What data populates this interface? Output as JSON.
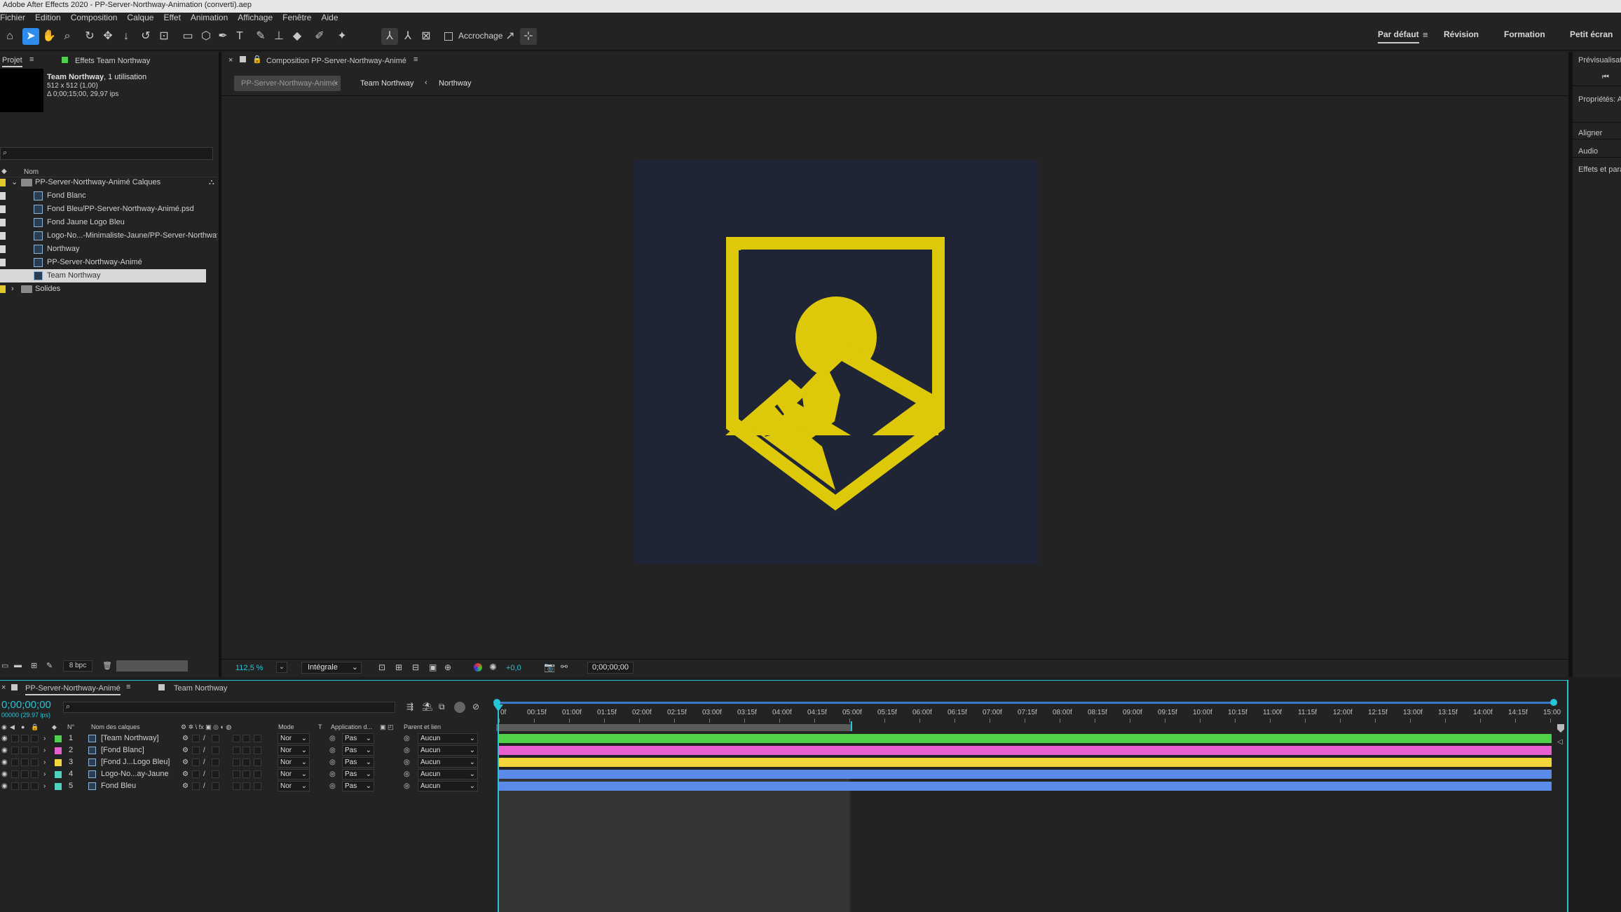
{
  "window_title": "Adobe After Effects 2020 - PP-Server-Northway-Animation (converti).aep",
  "menu": [
    "Fichier",
    "Edition",
    "Composition",
    "Calque",
    "Effet",
    "Animation",
    "Affichage",
    "Fenêtre",
    "Aide"
  ],
  "toolbar": {
    "snapping_label": "Accrochage",
    "workspaces": [
      "Par défaut",
      "Révision",
      "Formation",
      "Petit écran"
    ]
  },
  "project_panel": {
    "tab_label": "Projet",
    "effects_tab": "Effets Team Northway",
    "info_name": "Team Northway",
    "info_usage": ", 1 utilisation",
    "info_size": "512 x 512 (1,00)",
    "info_duration": "Δ 0;00;15;00, 29,97 ips",
    "search_placeholder": "",
    "col_name": "Nom",
    "items": [
      {
        "name": "PP-Server-Northway-Animé Calques",
        "type": "folder",
        "label_color": "#e0c72b"
      },
      {
        "name": "Fond Blanc",
        "type": "layer",
        "label_color": "#d8d8d8"
      },
      {
        "name": "Fond Bleu/PP-Server-Northway-Animé.psd",
        "type": "psd",
        "label_color": "#d8d8d8"
      },
      {
        "name": "Fond Jaune Logo Bleu",
        "type": "layer",
        "label_color": "#d8d8d8"
      },
      {
        "name": "Logo-No...-Minimaliste-Jaune/PP-Server-Northway",
        "type": "psd",
        "label_color": "#d8d8d8"
      },
      {
        "name": "Northway",
        "type": "comp",
        "label_color": "#d8d8d8"
      },
      {
        "name": "PP-Server-Northway-Animé",
        "type": "comp",
        "label_color": "#d8d8d8"
      },
      {
        "name": "Team Northway",
        "type": "comp",
        "label_color": "#d8d8d8",
        "selected": true
      },
      {
        "name": "Solides",
        "type": "folder",
        "label_color": "#e0c72b"
      }
    ],
    "bpc": "8 bpc"
  },
  "comp_panel": {
    "tab_label": "Composition PP-Server-Northway-Animé",
    "breadcrumbs": [
      "PP-Server-Northway-Animé",
      "Team Northway",
      "Northway"
    ],
    "zoom": "112,5 %",
    "resolution": "Intégrale",
    "exposure": "+0,0",
    "timecode": "0;00;00;00"
  },
  "right_panel": {
    "items": [
      "Prévisualisation",
      "Propriétés: A",
      "Aligner",
      "Audio",
      "Effets et paramètres"
    ]
  },
  "timeline": {
    "tabs": [
      "PP-Server-Northway-Animé",
      "Team Northway"
    ],
    "current_time": "0;00;00;00",
    "frame_info": "00000 (29.97 ips)",
    "col_num": "N°",
    "col_layer_name": "Nom des calques",
    "col_mode": "Mode",
    "col_t": "T",
    "col_track": "Application d...",
    "col_parent": "Parent et lien",
    "ruler": [
      "0f",
      "00:15f",
      "01:00f",
      "01:15f",
      "02:00f",
      "02:15f",
      "03:00f",
      "03:15f",
      "04:00f",
      "04:15f",
      "05:00f",
      "05:15f",
      "06:00f",
      "06:15f",
      "07:00f",
      "07:15f",
      "08:00f",
      "08:15f",
      "09:00f",
      "09:15f",
      "10:00f",
      "10:15f",
      "11:00f",
      "11:15f",
      "12:00f",
      "12:15f",
      "13:00f",
      "13:15f",
      "14:00f",
      "14:15f",
      "15:00"
    ],
    "layers": [
      {
        "num": "1",
        "name": "[Team Northway]",
        "mode": "Nor",
        "track": "Pas",
        "parent": "Aucun",
        "color": "#4fd14a",
        "label": "#4fd14a"
      },
      {
        "num": "2",
        "name": "[Fond Blanc]",
        "mode": "Nor",
        "track": "Pas",
        "parent": "Aucun",
        "color": "#e85fd0",
        "label": "#e85fd0"
      },
      {
        "num": "3",
        "name": "[Fond J...Logo Bleu]",
        "mode": "Nor",
        "track": "Pas",
        "parent": "Aucun",
        "color": "#f2d63a",
        "label": "#f2d63a"
      },
      {
        "num": "4",
        "name": "Logo-No...ay-Jaune",
        "mode": "Nor",
        "track": "Pas",
        "parent": "Aucun",
        "color": "#5a8be8",
        "label": "#4fd1c0"
      },
      {
        "num": "5",
        "name": "Fond Bleu",
        "mode": "Nor",
        "track": "Pas",
        "parent": "Aucun",
        "color": "#5a8be8",
        "label": "#4fd1c0"
      }
    ]
  },
  "colors": {
    "accent": "#2d8ceb",
    "cyan": "#27c4d8",
    "logo_yellow": "#ddc80a",
    "canvas_bg": "#1f2535"
  }
}
